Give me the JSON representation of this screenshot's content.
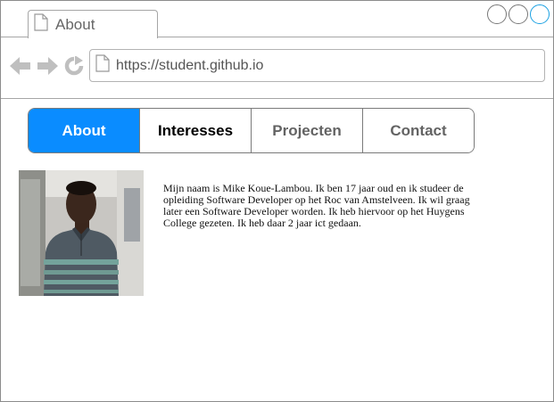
{
  "browser": {
    "tab_title": "About",
    "url": "https://student.github.io",
    "window_controls": [
      "minimize",
      "maximize",
      "close"
    ],
    "nav_icons": [
      "back-arrow-icon",
      "forward-arrow-icon",
      "reload-icon"
    ]
  },
  "menu": {
    "items": [
      {
        "label": "About",
        "active": true
      },
      {
        "label": "Interesses",
        "active": false
      },
      {
        "label": "Projecten",
        "active": false
      },
      {
        "label": "Contact",
        "active": false
      }
    ]
  },
  "content": {
    "bio": "Mijn naam is Mike Koue-Lambou. Ik ben 17 jaar oud en ik studeer de opleiding Software Developer op het Roc van Amstelveen. Ik wil graag later een Software Developer worden. Ik heb hiervoor op het Huygens College gezeten. Ik heb daar 2 jaar ict gedaan."
  },
  "colors": {
    "accent": "#0a8cff",
    "frame": "#a6a6a6",
    "icon_gray": "#bfbfbf"
  }
}
